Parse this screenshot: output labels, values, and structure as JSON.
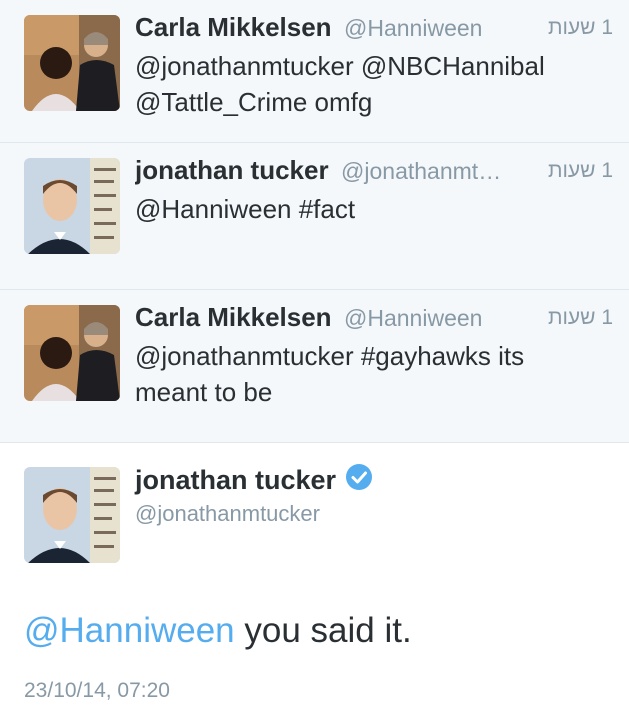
{
  "tweets": [
    {
      "name": "Carla Mikkelsen",
      "handle": "@Hanniween",
      "time": "1 שעות",
      "text": "@jonathanmtucker @NBCHannibal @Tattle_Crime omfg",
      "avatar": "carla-avatar"
    },
    {
      "name": "jonathan tucker",
      "handle": "@jonathanmt…",
      "time": "1 שעות",
      "text": "@Hanniween #fact",
      "avatar": "jonathan-avatar"
    },
    {
      "name": "Carla Mikkelsen",
      "handle": "@Hanniween",
      "time": "1 שעות",
      "text": "@jonathanmtucker #gayhawks its meant to be",
      "avatar": "carla-avatar"
    }
  ],
  "detail": {
    "name": "jonathan tucker",
    "handle": "@jonathanmtucker",
    "verified_icon": "verified-badge-icon",
    "mention": "@Hanniween",
    "text_rest": " you said it.",
    "date": "23/10/14, 07:20"
  },
  "colors": {
    "link": "#55acee",
    "muted": "#8899a6",
    "row_bg": "#f5f8fa"
  }
}
